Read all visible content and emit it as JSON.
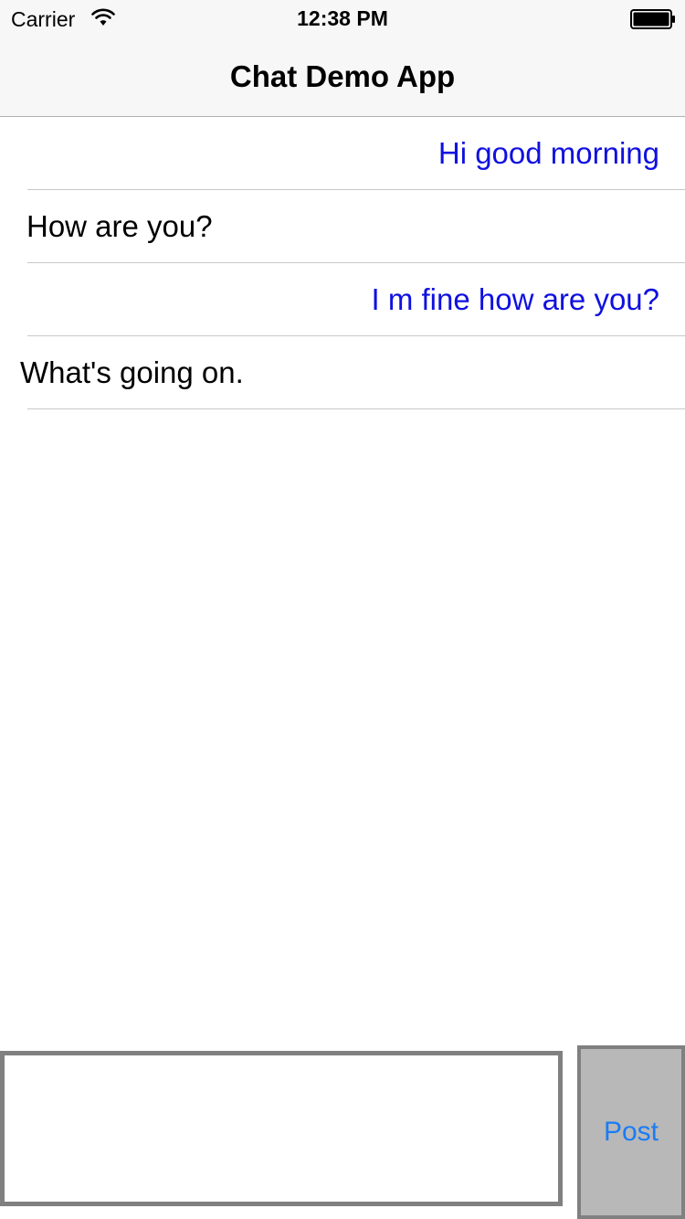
{
  "status_bar": {
    "carrier": "Carrier",
    "time": "12:38 PM",
    "wifi_icon": "wifi-icon",
    "battery_icon": "battery-full-icon"
  },
  "nav": {
    "title": "Chat Demo App"
  },
  "messages": [
    {
      "text": "Hi good morning",
      "direction": "sent"
    },
    {
      "text": "How are you?",
      "direction": "received"
    },
    {
      "text": "I m fine how are you?",
      "direction": "sent"
    },
    {
      "text": "What's going on.",
      "direction": "received"
    }
  ],
  "composer": {
    "input_value": "",
    "post_label": "Post"
  },
  "colors": {
    "sent_text": "#1010e0",
    "received_text": "#000000",
    "post_label": "#1a7cf5",
    "post_background": "#b8b8b8",
    "bar_background": "#f7f7f7"
  }
}
